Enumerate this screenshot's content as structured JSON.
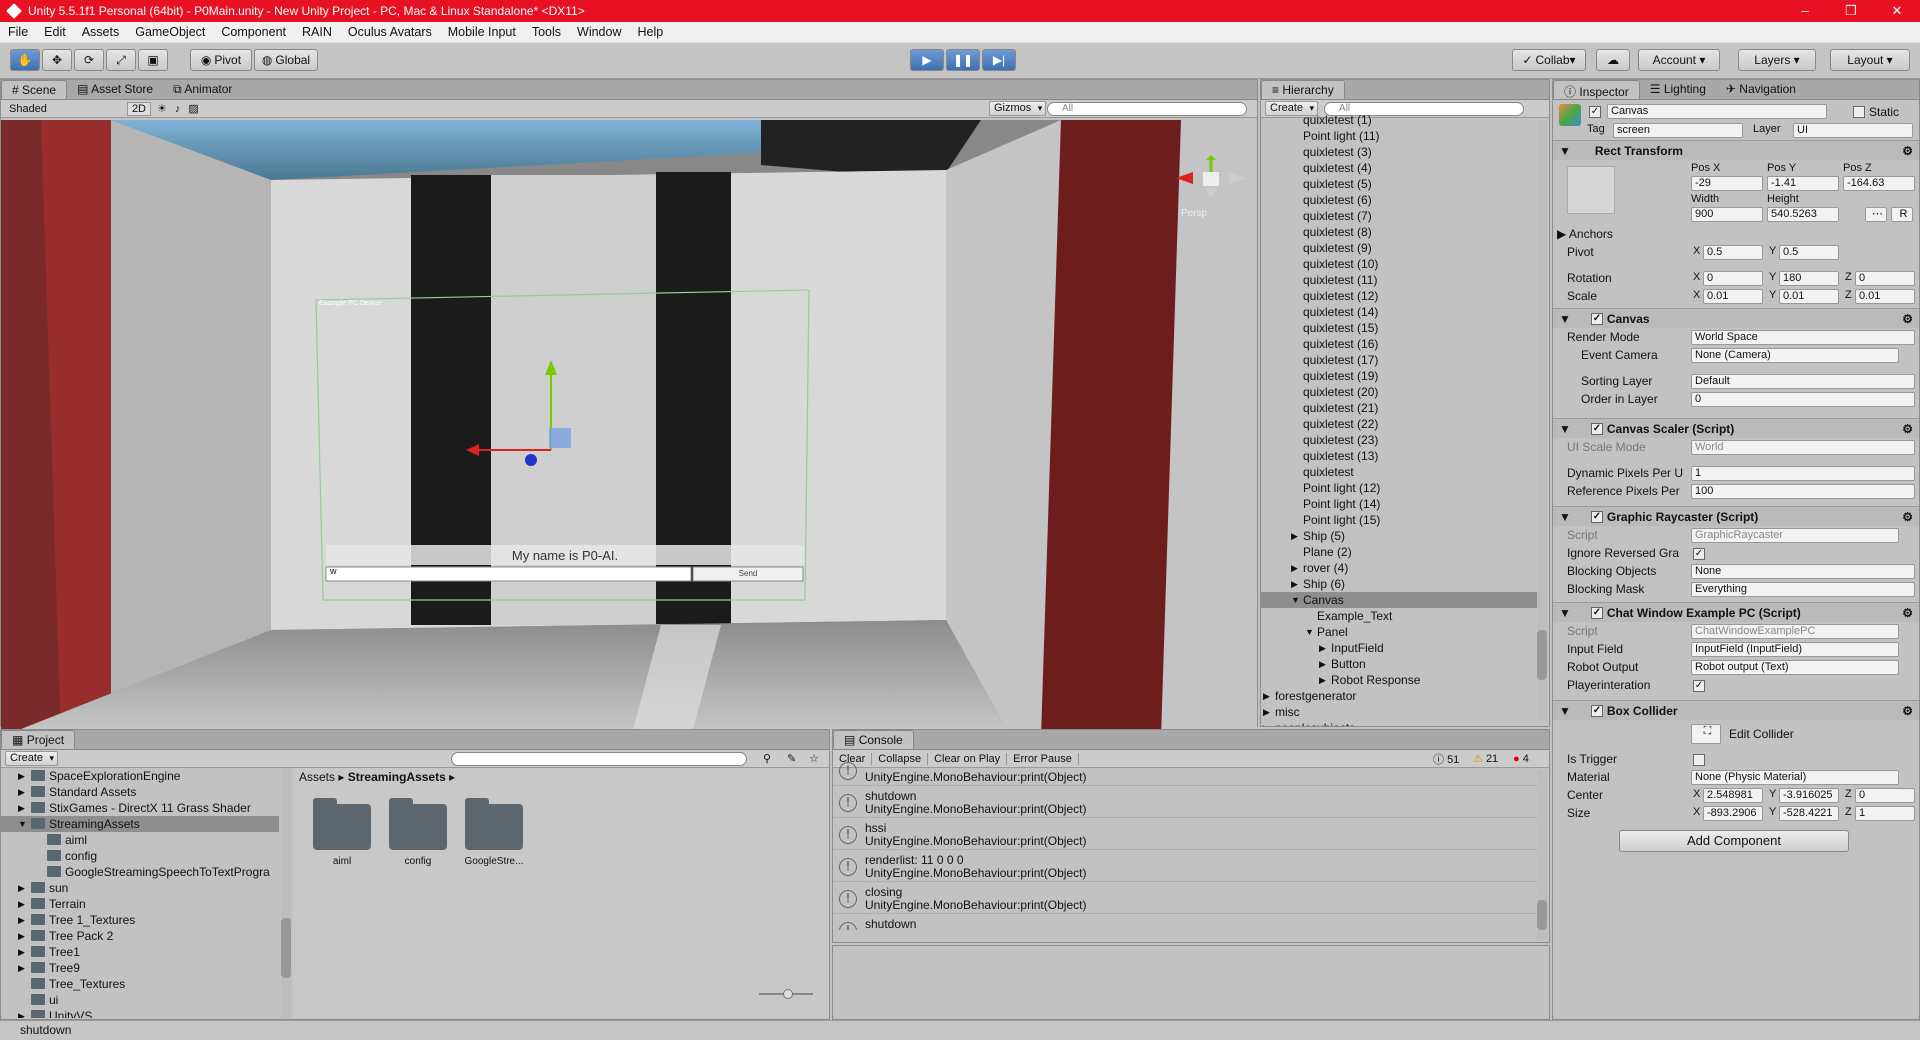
{
  "window": {
    "title": "Unity 5.5.1f1 Personal (64bit) - P0Main.unity - New Unity Project - PC, Mac & Linux Standalone* <DX11>",
    "minimize": "–",
    "maximize": "❐",
    "close": "✕"
  },
  "menu": [
    "File",
    "Edit",
    "Assets",
    "GameObject",
    "Component",
    "RAIN",
    "Oculus Avatars",
    "Mobile Input",
    "Tools",
    "Window",
    "Help"
  ],
  "toolbar": {
    "pivot": "Pivot",
    "global": "Global",
    "collab": "Collab",
    "account": "Account",
    "layers": "Layers",
    "layout": "Layout"
  },
  "scene": {
    "tabs": [
      "Scene",
      "Asset Store",
      "Animator"
    ],
    "shading": "Shaded",
    "mode2d": "2D",
    "gizmos": "Gizmos",
    "search_placeholder": "All",
    "persp": "Persp",
    "canvas_title": "Example PC Device",
    "chat_text": "My name is P0-AI.",
    "input_value": "w",
    "send": "Send"
  },
  "hierarchy": {
    "tab": "Hierarchy",
    "create": "Create",
    "search_placeholder": "All",
    "items": [
      {
        "label": "quixletest (1)",
        "indent": 0,
        "arrow": ""
      },
      {
        "label": "Point light (11)",
        "indent": 0,
        "arrow": ""
      },
      {
        "label": "quixletest (3)",
        "indent": 0,
        "arrow": ""
      },
      {
        "label": "quixletest (4)",
        "indent": 0,
        "arrow": ""
      },
      {
        "label": "quixletest (5)",
        "indent": 0,
        "arrow": ""
      },
      {
        "label": "quixletest (6)",
        "indent": 0,
        "arrow": ""
      },
      {
        "label": "quixletest (7)",
        "indent": 0,
        "arrow": ""
      },
      {
        "label": "quixletest (8)",
        "indent": 0,
        "arrow": ""
      },
      {
        "label": "quixletest (9)",
        "indent": 0,
        "arrow": ""
      },
      {
        "label": "quixletest (10)",
        "indent": 0,
        "arrow": ""
      },
      {
        "label": "quixletest (11)",
        "indent": 0,
        "arrow": ""
      },
      {
        "label": "quixletest (12)",
        "indent": 0,
        "arrow": ""
      },
      {
        "label": "quixletest (14)",
        "indent": 0,
        "arrow": ""
      },
      {
        "label": "quixletest (15)",
        "indent": 0,
        "arrow": ""
      },
      {
        "label": "quixletest (16)",
        "indent": 0,
        "arrow": ""
      },
      {
        "label": "quixletest (17)",
        "indent": 0,
        "arrow": ""
      },
      {
        "label": "quixletest (19)",
        "indent": 0,
        "arrow": ""
      },
      {
        "label": "quixletest (20)",
        "indent": 0,
        "arrow": ""
      },
      {
        "label": "quixletest (21)",
        "indent": 0,
        "arrow": ""
      },
      {
        "label": "quixletest (22)",
        "indent": 0,
        "arrow": ""
      },
      {
        "label": "quixletest (23)",
        "indent": 0,
        "arrow": ""
      },
      {
        "label": "quixletest (13)",
        "indent": 0,
        "arrow": ""
      },
      {
        "label": "quixletest",
        "indent": 0,
        "arrow": ""
      },
      {
        "label": "Point light (12)",
        "indent": 0,
        "arrow": ""
      },
      {
        "label": "Point light (14)",
        "indent": 0,
        "arrow": ""
      },
      {
        "label": "Point light (15)",
        "indent": 0,
        "arrow": ""
      },
      {
        "label": "Ship (5)",
        "indent": 0,
        "arrow": "▶"
      },
      {
        "label": "Plane (2)",
        "indent": 0,
        "arrow": ""
      },
      {
        "label": "rover (4)",
        "indent": 0,
        "arrow": "▶"
      },
      {
        "label": "Ship (6)",
        "indent": 0,
        "arrow": "▶"
      },
      {
        "label": "Canvas",
        "indent": 0,
        "arrow": "▼",
        "selected": true
      },
      {
        "label": "Example_Text",
        "indent": 1,
        "arrow": ""
      },
      {
        "label": "Panel",
        "indent": 1,
        "arrow": "▼"
      },
      {
        "label": "InputField",
        "indent": 2,
        "arrow": "▶"
      },
      {
        "label": "Button",
        "indent": 2,
        "arrow": "▶"
      },
      {
        "label": "Robot Response",
        "indent": 2,
        "arrow": "▶"
      },
      {
        "label": "forestgenerator",
        "indent": -1,
        "arrow": "▶"
      },
      {
        "label": "misc",
        "indent": -1,
        "arrow": "▶"
      },
      {
        "label": "peoplesubjects",
        "indent": -1,
        "arrow": "▶"
      }
    ]
  },
  "inspector": {
    "tabs": [
      "Inspector",
      "Lighting",
      "Navigation"
    ],
    "object_name": "Canvas",
    "static": "Static",
    "tag_label": "Tag",
    "tag": "screen",
    "layer_label": "Layer",
    "layer": "UI",
    "rect": {
      "title": "Rect Transform",
      "posx_l": "Pos X",
      "posy_l": "Pos Y",
      "posz_l": "Pos Z",
      "posx": "-29",
      "posy": "-1.41",
      "posz": "-164.63",
      "width_l": "Width",
      "height_l": "Height",
      "width": "900",
      "height": "540.5263",
      "anchors": "Anchors",
      "pivot": "Pivot",
      "pivot_x": "0.5",
      "pivot_y": "0.5",
      "rotation": "Rotation",
      "rot_x": "0",
      "rot_y": "180",
      "rot_z": "0",
      "scale": "Scale",
      "sc_x": "0.01",
      "sc_y": "0.01",
      "sc_z": "0.01",
      "x": "X",
      "y": "Y",
      "z": "Z",
      "r": "R"
    },
    "canvas": {
      "title": "Canvas",
      "render_mode_l": "Render Mode",
      "render_mode": "World Space",
      "event_camera_l": "Event Camera",
      "event_camera": "None (Camera)",
      "sorting_layer_l": "Sorting Layer",
      "sorting_layer": "Default",
      "order_l": "Order in Layer",
      "order": "0"
    },
    "scaler": {
      "title": "Canvas Scaler (Script)",
      "ui_scale_l": "UI Scale Mode",
      "ui_scale": "World",
      "dyn_l": "Dynamic Pixels Per U",
      "dyn": "1",
      "ref_l": "Reference Pixels Per",
      "ref": "100"
    },
    "raycaster": {
      "title": "Graphic Raycaster (Script)",
      "script_l": "Script",
      "script": "GraphicRaycaster",
      "ignore_l": "Ignore Reversed Gra",
      "blocking_l": "Blocking Objects",
      "blocking": "None",
      "mask_l": "Blocking Mask",
      "mask": "Everything"
    },
    "chat": {
      "title": "Chat Window Example PC (Script)",
      "script_l": "Script",
      "script": "ChatWindowExamplePC",
      "input_l": "Input Field",
      "input": "InputField (InputField)",
      "robot_l": "Robot Output",
      "robot": "Robot output (Text)",
      "player_l": "Playerinteration"
    },
    "box": {
      "title": "Box Collider",
      "edit": "Edit Collider",
      "trigger_l": "Is Trigger",
      "material_l": "Material",
      "material": "None (Physic Material)",
      "center_l": "Center",
      "cx": "2.548981",
      "cy": "-3.916025",
      "cz": "0",
      "size_l": "Size",
      "sx": "-893.2906",
      "sy": "-528.4221",
      "sz": "1"
    },
    "add_component": "Add Component"
  },
  "project": {
    "tab": "Project",
    "create": "Create",
    "tree": [
      {
        "label": "SpaceExplorationEngine",
        "indent": 1,
        "arrow": "▶"
      },
      {
        "label": "Standard Assets",
        "indent": 1,
        "arrow": "▶"
      },
      {
        "label": "StixGames - DirectX 11 Grass Shader",
        "indent": 1,
        "arrow": "▶"
      },
      {
        "label": "StreamingAssets",
        "indent": 1,
        "arrow": "▼",
        "selected": true
      },
      {
        "label": "aiml",
        "indent": 2,
        "arrow": ""
      },
      {
        "label": "config",
        "indent": 2,
        "arrow": ""
      },
      {
        "label": "GoogleStreamingSpeechToTextProgra",
        "indent": 2,
        "arrow": ""
      },
      {
        "label": "sun",
        "indent": 1,
        "arrow": "▶"
      },
      {
        "label": "Terrain",
        "indent": 1,
        "arrow": "▶"
      },
      {
        "label": "Tree 1_Textures",
        "indent": 1,
        "arrow": "▶"
      },
      {
        "label": "Tree Pack 2",
        "indent": 1,
        "arrow": "▶"
      },
      {
        "label": "Tree1",
        "indent": 1,
        "arrow": "▶"
      },
      {
        "label": "Tree9",
        "indent": 1,
        "arrow": "▶"
      },
      {
        "label": "Tree_Textures",
        "indent": 1,
        "arrow": ""
      },
      {
        "label": "ui",
        "indent": 1,
        "arrow": ""
      },
      {
        "label": "UnityVS",
        "indent": 1,
        "arrow": "▶"
      }
    ],
    "breadcrumb": [
      "Assets",
      "StreamingAssets"
    ],
    "folders": [
      "aiml",
      "config",
      "GoogleStre..."
    ]
  },
  "console": {
    "tab": "Console",
    "clear": "Clear",
    "collapse": "Collapse",
    "clear_on_play": "Clear on Play",
    "error_pause": "Error Pause",
    "info_count": "51",
    "warn_count": "21",
    "error_count": "4",
    "rows": [
      {
        "line1": "",
        "line2": "UnityEngine.MonoBehaviour:print(Object)"
      },
      {
        "line1": "shutdown",
        "line2": "UnityEngine.MonoBehaviour:print(Object)"
      },
      {
        "line1": "hssi",
        "line2": "UnityEngine.MonoBehaviour:print(Object)"
      },
      {
        "line1": "renderlist: 11 0 0 0",
        "line2": "UnityEngine.MonoBehaviour:print(Object)"
      },
      {
        "line1": "closing",
        "line2": "UnityEngine.MonoBehaviour:print(Object)"
      },
      {
        "line1": "shutdown",
        "line2": "UnityEngine.MonoBehaviour:print(Object)"
      }
    ]
  },
  "status": {
    "text": "shutdown"
  }
}
